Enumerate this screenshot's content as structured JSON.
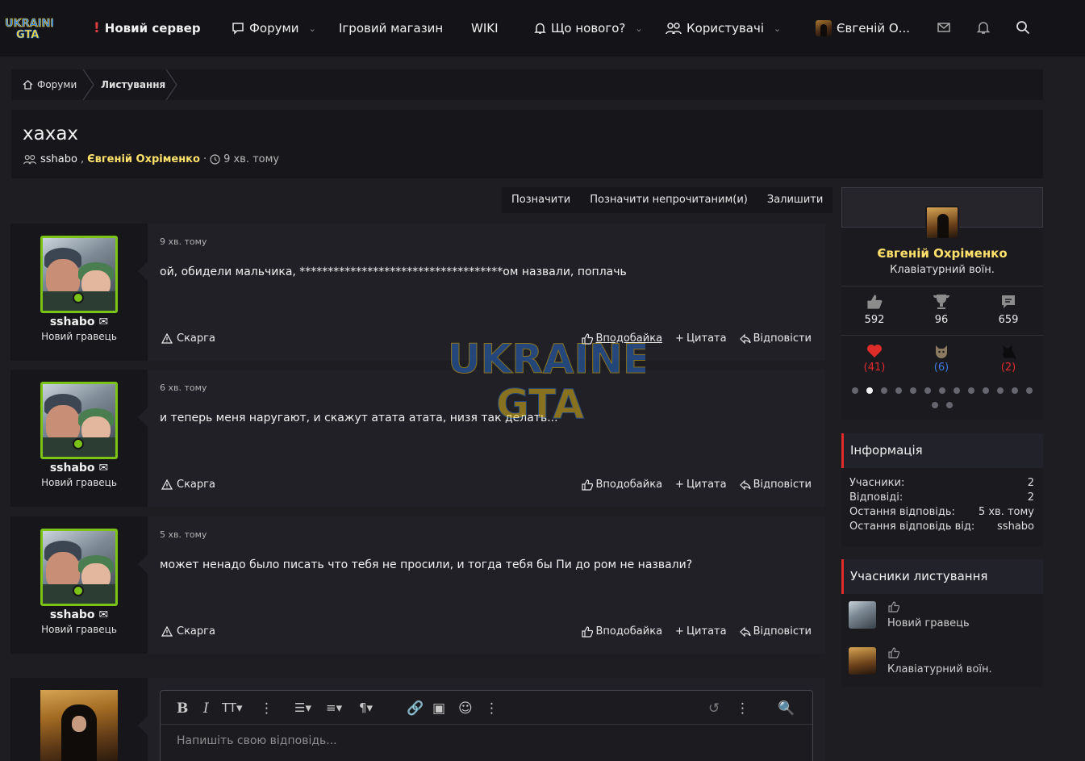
{
  "header": {
    "nav": {
      "new_server": "Новий сервер",
      "forums": "Форуми",
      "store": "Ігровий магазин",
      "wiki": "WIKI",
      "whats_new": "Що нового?",
      "users": "Користувачі",
      "account": "Євгеній О..."
    }
  },
  "breadcrumb": {
    "home": "Форуми",
    "current": "Листування"
  },
  "thread": {
    "title": "xaxax",
    "participants": [
      "sshabo",
      "Євгеній Охріменко"
    ],
    "separator": ",",
    "time_sep": "·",
    "time": "9 хв. тому"
  },
  "thread_actions": [
    "Позначити",
    "Позначити непрочитаним(и)",
    "Залишити"
  ],
  "post_actions": {
    "report": "Скарга",
    "like": "Вподобайка",
    "quote": "Цитата",
    "reply": "Відповісти"
  },
  "posts": [
    {
      "author": "sshabo",
      "user_title": "Новий гравець",
      "time": "9 хв. тому",
      "text": "ой, обидели мальчика, ************************************ом назвали, поплачь"
    },
    {
      "author": "sshabo",
      "user_title": "Новий гравець",
      "time": "6 хв. тому",
      "text": "и теперь меня наругают, и скажут атата атата, низя так делать..."
    },
    {
      "author": "sshabo",
      "user_title": "Новий гравець",
      "time": "5 хв. тому",
      "text": "может ненадо было писать что тебя не просили, и тогда тебя бы Пи до ром не назвали?"
    }
  ],
  "editor": {
    "placeholder": "Напишіть свою відповідь..."
  },
  "profile": {
    "name": "Євгеній Охріменко",
    "title": "Клавіатурний воїн.",
    "stats": {
      "likes": "592",
      "trophies": "96",
      "messages": "659"
    },
    "reactions": {
      "heart": "(41)",
      "cat": "(6)",
      "black_cat": "(2)"
    },
    "carousel": {
      "total": 15,
      "active": 2
    }
  },
  "info": {
    "heading": "Інформація",
    "rows": [
      {
        "label": "Учасники:",
        "value": "2"
      },
      {
        "label": "Відповіді:",
        "value": "2"
      },
      {
        "label": "Остання відповідь:",
        "value": "5 хв. тому"
      },
      {
        "label": "Остання відповідь від:",
        "value": "sshabo"
      }
    ]
  },
  "members": {
    "heading": "Учасники листування",
    "list": [
      {
        "title": "Новий гравець"
      },
      {
        "title": "Клавіатурний воїн."
      }
    ]
  },
  "colors": {
    "accent_name": "#ffe16b",
    "online": "#7bc416",
    "block_marker": "#e02b2b",
    "reaction_red": "#e02b2b",
    "reaction_blue": "#3d7be0"
  }
}
